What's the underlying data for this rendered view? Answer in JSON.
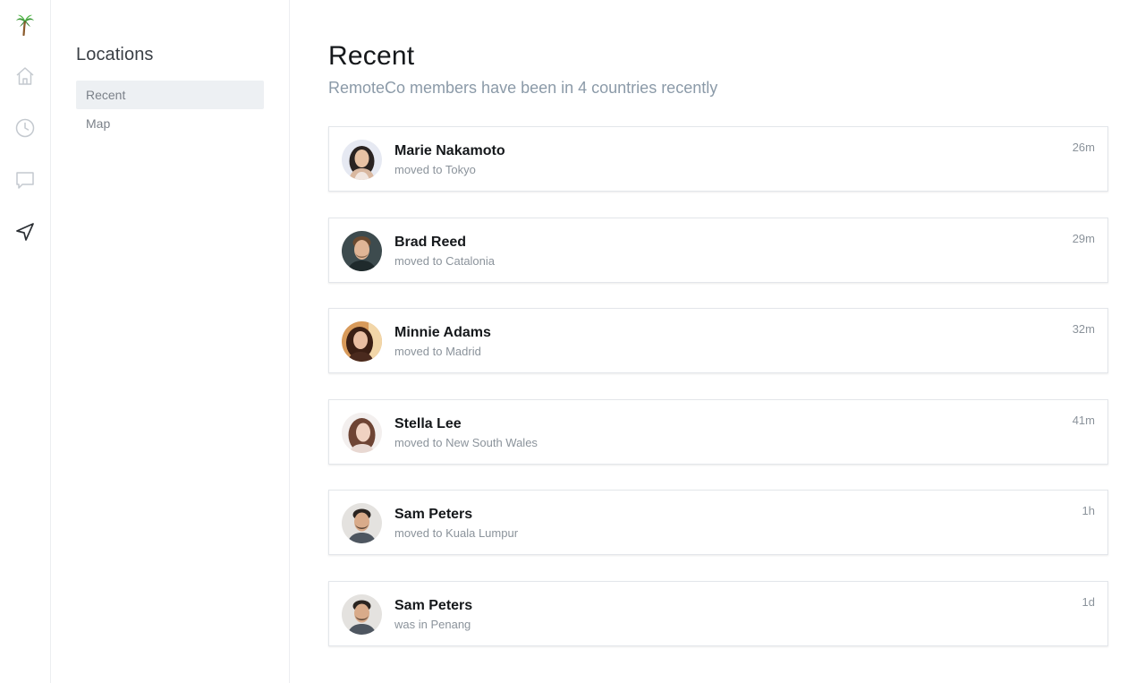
{
  "rail": {
    "items": [
      {
        "icon": "palm-tree-logo-icon"
      },
      {
        "icon": "home-icon"
      },
      {
        "icon": "clock-icon"
      },
      {
        "icon": "chat-icon"
      },
      {
        "icon": "navigation-arrow-icon"
      }
    ]
  },
  "subnav": {
    "title": "Locations",
    "items": [
      {
        "label": "Recent",
        "active": true
      },
      {
        "label": "Map",
        "active": false
      }
    ]
  },
  "main": {
    "title": "Recent",
    "subtitle": "RemoteCo members have been in 4 countries recently"
  },
  "feed": [
    {
      "name": "Marie Nakamoto",
      "detail": "moved to Tokyo",
      "time": "26m"
    },
    {
      "name": "Brad Reed",
      "detail": "moved to Catalonia",
      "time": "29m"
    },
    {
      "name": "Minnie Adams",
      "detail": "moved to Madrid",
      "time": "32m"
    },
    {
      "name": "Stella Lee",
      "detail": "moved to New South Wales",
      "time": "41m"
    },
    {
      "name": "Sam Peters",
      "detail": "moved to Kuala Lumpur",
      "time": "1h"
    },
    {
      "name": "Sam Peters",
      "detail": "was in Penang",
      "time": "1d"
    }
  ]
}
